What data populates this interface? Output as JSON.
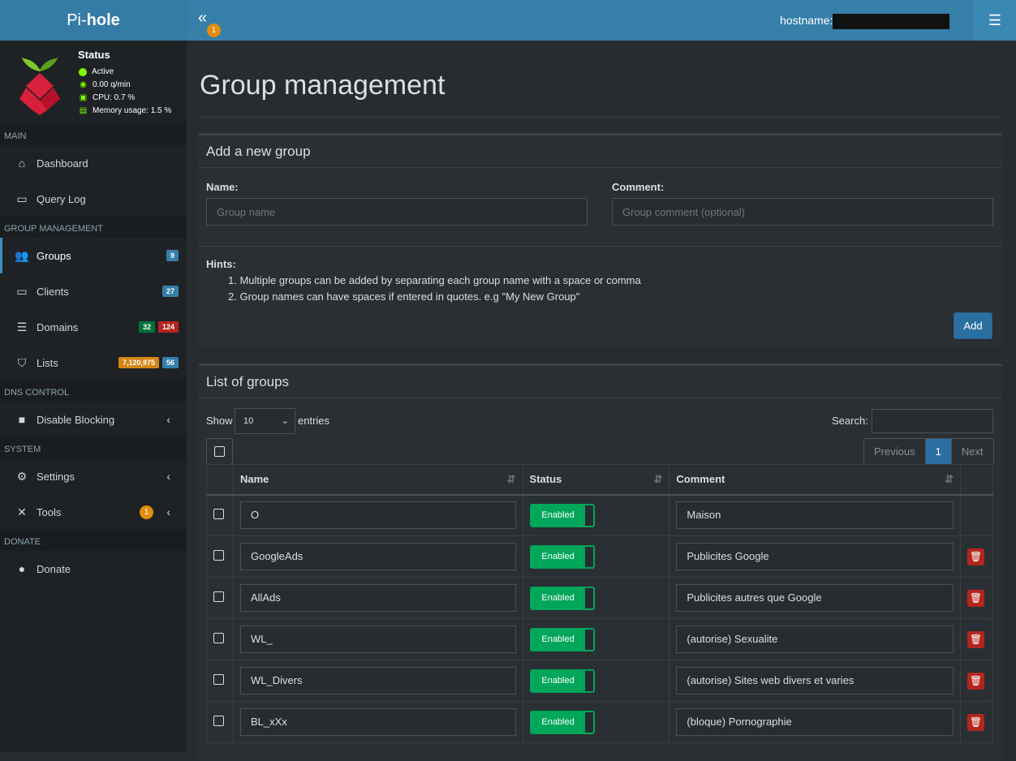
{
  "app": {
    "logo_pre": "Pi-",
    "logo_bold": "hole",
    "toggle_badge": "1",
    "hostname_label": "hostname:"
  },
  "status": {
    "title": "Status",
    "active": "Active",
    "qpm": "0.00 q/min",
    "cpu": "CPU: 0.7 %",
    "memory": "Memory usage: 1.5 %"
  },
  "sidebar": {
    "sec_main": "MAIN",
    "dashboard": "Dashboard",
    "querylog": "Query Log",
    "sec_group": "GROUP MANAGEMENT",
    "groups": "Groups",
    "groups_count": "9",
    "clients": "Clients",
    "clients_count": "27",
    "domains": "Domains",
    "domains_allow": "32",
    "domains_deny": "124",
    "lists": "Lists",
    "lists_domains": "7,120,975",
    "lists_count": "56",
    "sec_dns": "DNS CONTROL",
    "disable": "Disable Blocking",
    "sec_system": "SYSTEM",
    "settings": "Settings",
    "tools": "Tools",
    "tools_badge": "1",
    "sec_donate": "DONATE",
    "donate": "Donate"
  },
  "page": {
    "title": "Group management"
  },
  "add_box": {
    "title": "Add a new group",
    "name_label": "Name:",
    "name_placeholder": "Group name",
    "comment_label": "Comment:",
    "comment_placeholder": "Group comment (optional)",
    "hints_label": "Hints:",
    "hint1": "1. Multiple groups can be added by separating each group name with a space or comma",
    "hint2": "2. Group names can have spaces if entered in quotes. e.g \"My New Group\"",
    "add_button": "Add"
  },
  "list_box": {
    "title": "List of groups",
    "show": "Show",
    "entries_value": "10",
    "entries": "entries",
    "search": "Search:",
    "prev": "Previous",
    "page": "1",
    "next": "Next",
    "col_name": "Name",
    "col_status": "Status",
    "col_comment": "Comment",
    "rows": [
      {
        "name": "O",
        "status": "Enabled",
        "comment": "Maison"
      },
      {
        "name": "GoogleAds",
        "status": "Enabled",
        "comment": "Publicites Google"
      },
      {
        "name": "AllAds",
        "status": "Enabled",
        "comment": "Publicites autres que Google"
      },
      {
        "name": "WL_",
        "status": "Enabled",
        "comment": "(autorise) Sexualite"
      },
      {
        "name": "WL_Divers",
        "status": "Enabled",
        "comment": "(autorise) Sites web divers et varies"
      },
      {
        "name": "BL_xXx",
        "status": "Enabled",
        "comment": "(bloque) Pornographie"
      }
    ]
  }
}
